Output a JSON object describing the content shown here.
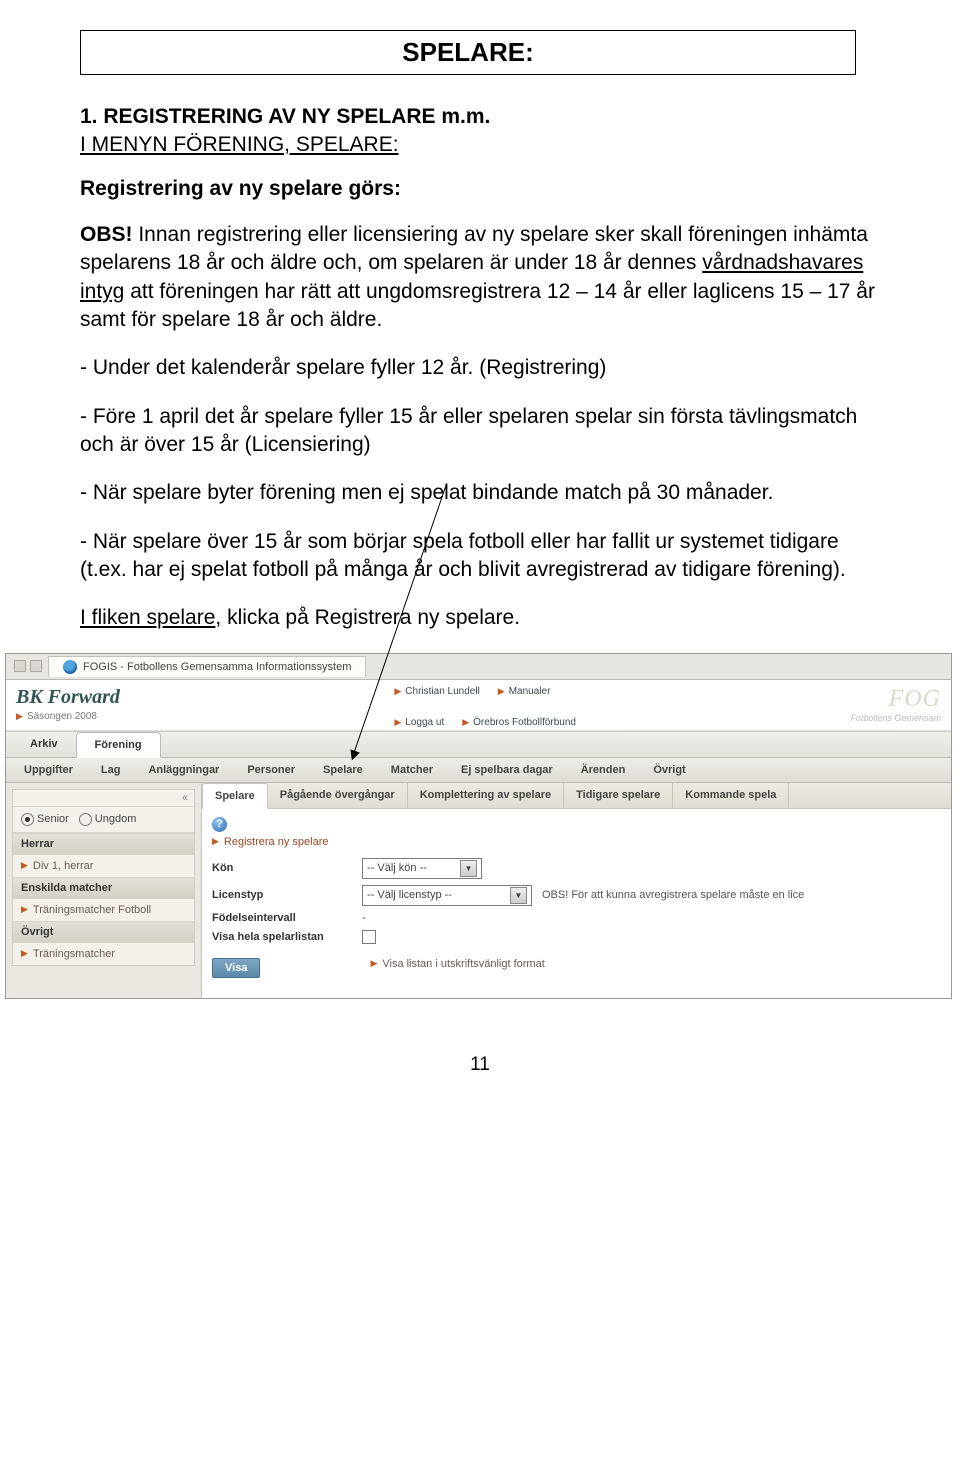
{
  "doc": {
    "title": "SPELARE:",
    "section_num": "1.  REGISTRERING AV NY SPELARE m.m.",
    "section_link": "I MENYN FÖRENING, SPELARE:",
    "subhead": "Registrering av ny spelare görs:",
    "p1_a": "OBS!",
    "p1_b": " Innan registrering eller licensiering av ny spelare sker skall föreningen inhämta spelarens 18 år och äldre och, om spelaren är under 18 år dennes ",
    "p1_c": "vårdnadshavares intyg",
    "p1_d": " att föreningen har rätt att ungdomsregistrera 12 – 14 år eller laglicens 15 – 17 år samt för spelare 18 år och äldre.",
    "p2": "- Under det kalenderår spelare fyller 12 år. (Registrering)",
    "p3": "- Före 1 april det år spelare fyller 15 år eller spelaren spelar sin första tävlingsmatch och är över 15 år (Licensiering)",
    "p4": "- När spelare byter förening men ej spelat bindande match på 30 månader.",
    "p5": "- När spelare över 15 år som börjar spela fotboll eller har fallit ur systemet tidigare (t.ex. har ej spelat fotboll på många år och blivit avregistrerad av tidigare förening).",
    "p6_a": "I fliken spelare",
    "p6_b": ", klicka på Registrera ny spelare.",
    "page_num": "11"
  },
  "screenshot": {
    "tab_title": "FOGIS - Fotbollens Gemensamma Informationssystem",
    "club_name": "BK Forward",
    "season": "Säsongen 2008",
    "banner_links": {
      "row1": [
        "Christian Lundell",
        "Manualer"
      ],
      "row2": [
        "Logga ut",
        "Örebros Fotbollförbund"
      ]
    },
    "fog": "FOG",
    "fog_sub": "Fotbollens Gemensam",
    "main_nav": {
      "arkiv": "Arkiv",
      "forening": "Förening"
    },
    "sub_nav": [
      "Uppgifter",
      "Lag",
      "Anläggningar",
      "Personer",
      "Spelare",
      "Matcher",
      "Ej spelbara dagar",
      "Ärenden",
      "Övrigt"
    ],
    "sidebar": {
      "collapse": "«",
      "radio_senior": "Senior",
      "radio_ungdom": "Ungdom",
      "head_herrar": "Herrar",
      "item_div1": "Div 1, herrar",
      "head_enskilda": "Enskilda matcher",
      "item_tran_fotboll": "Träningsmatcher Fotboll",
      "head_ovrigt": "Övrigt",
      "item_tran": "Träningsmatcher"
    },
    "content_tabs": [
      "Spelare",
      "Pågående övergångar",
      "Komplettering av spelare",
      "Tidigare spelare",
      "Kommande spela"
    ],
    "help": "?",
    "reg_link": "Registrera ny spelare",
    "form": {
      "kon_label": "Kön",
      "kon_value": "-- Välj kön --",
      "lic_label": "Licenstyp",
      "lic_value": "-- Välj licenstyp --",
      "lic_note": "OBS! För att kunna avregistrera spelare måste en lice",
      "fod_label": "Födelseintervall",
      "fod_value": "-",
      "visa_label": "Visa hela spelarlistan",
      "visa_btn": "Visa",
      "print_link": "Visa listan i utskriftsvänligt format"
    }
  }
}
